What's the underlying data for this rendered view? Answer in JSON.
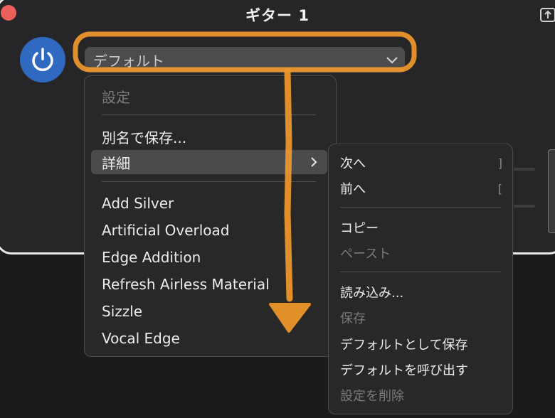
{
  "window": {
    "title": "ギター 1"
  },
  "preset": {
    "selected": "デフォルト"
  },
  "main_menu": {
    "settings_header": "設定",
    "save_as": "別名で保存...",
    "details": "詳細",
    "presets": [
      "Add Silver",
      "Artificial Overload",
      "Edge Addition",
      "Refresh Airless Material",
      "Sizzle",
      "Vocal Edge"
    ]
  },
  "sub_menu": {
    "next": "次へ",
    "next_shortcut": "]",
    "prev": "前へ",
    "prev_shortcut": "[",
    "copy": "コピー",
    "paste": "ペースト",
    "load": "読み込み...",
    "save": "保存",
    "save_default": "デフォルトとして保存",
    "recall_default": "デフォルトを呼び出す",
    "delete_setting": "設定を削除"
  },
  "colors": {
    "power_button": "#2f6ac0",
    "annotation": "#f0982a",
    "close_button": "#ec5f5a"
  }
}
